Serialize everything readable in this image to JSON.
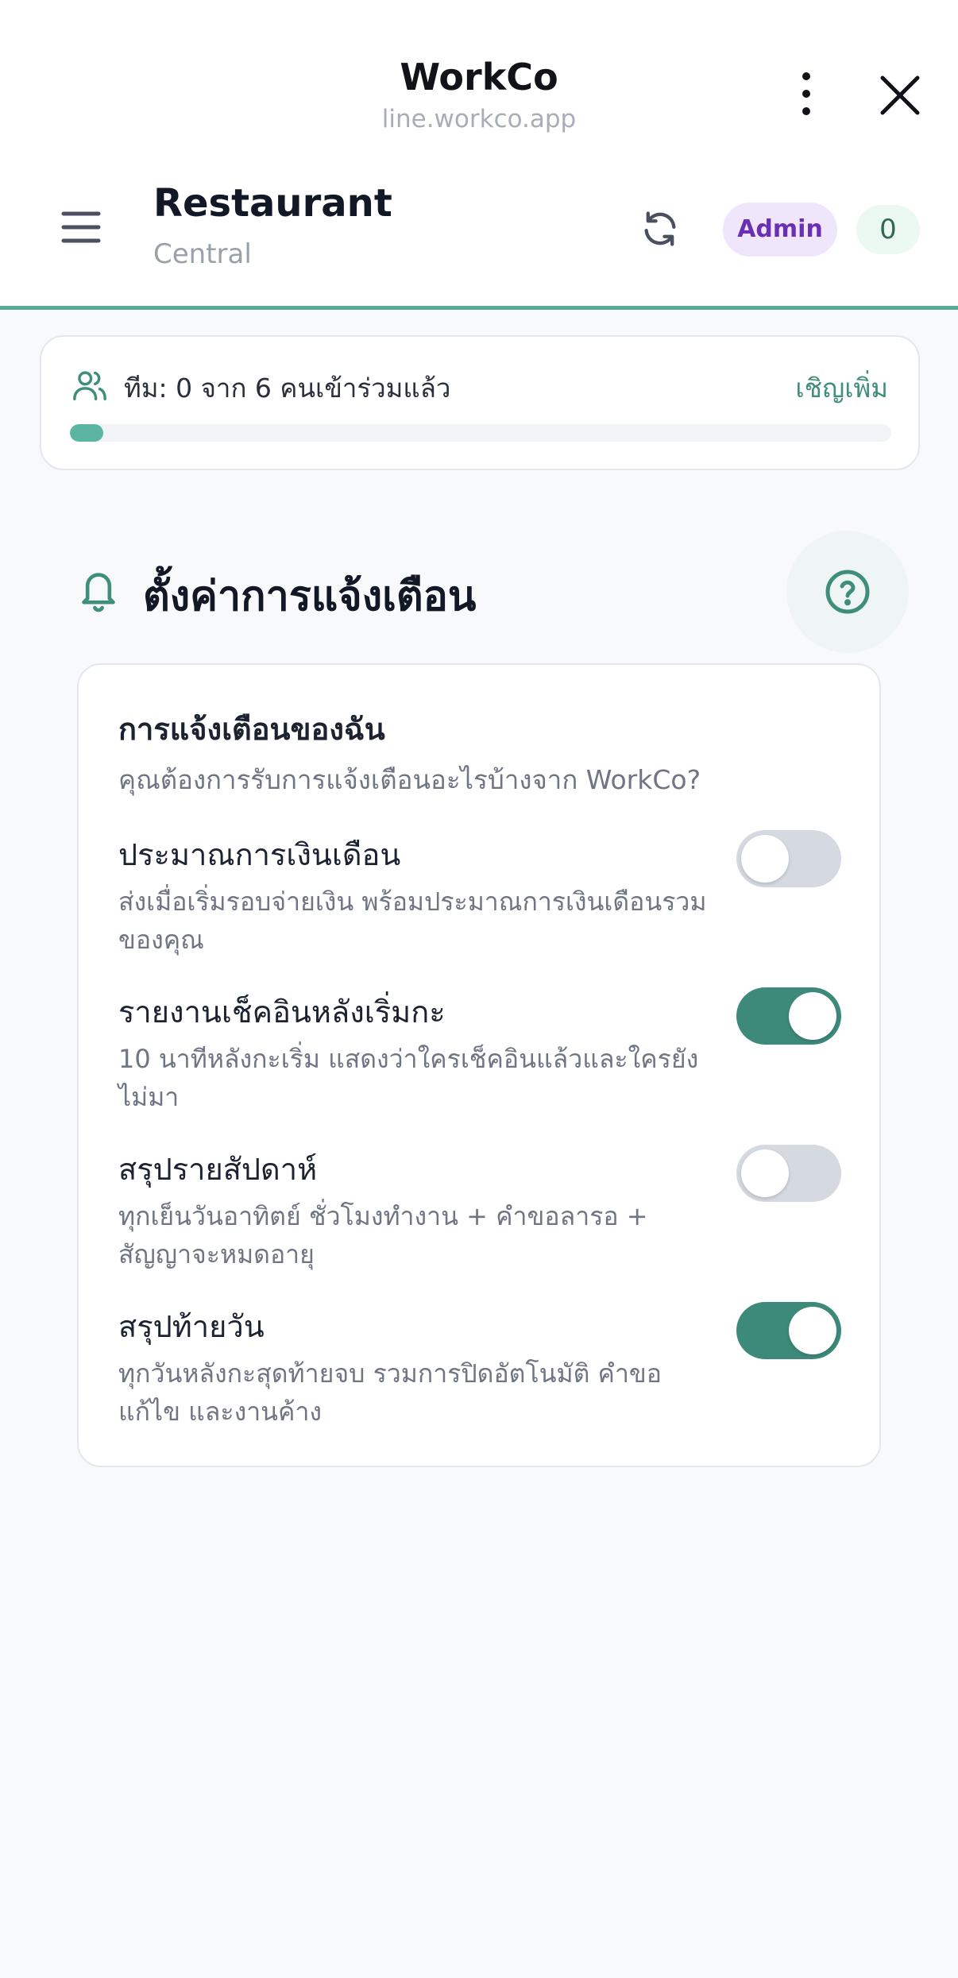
{
  "liff": {
    "title": "WorkCo",
    "url": "line.workco.app"
  },
  "header": {
    "workspace_name": "Restaurant",
    "branch": "Central",
    "role_badge": "Admin",
    "count_badge": "0"
  },
  "team": {
    "status_text": "ทีม: 0 จาก 6 คนเข้าร่วมแล้ว",
    "invite_label": "เชิญเพิ่ม",
    "joined": 0,
    "total": 6
  },
  "section": {
    "title": "ตั้งค่าการแจ้งเตือน"
  },
  "notifications": {
    "card_title": "การแจ้งเตือนของฉัน",
    "card_subtitle": "คุณต้องการรับการแจ้งเตือนอะไรบ้างจาก WorkCo?",
    "items": [
      {
        "name": "ประมาณการเงินเดือน",
        "desc": "ส่งเมื่อเริ่มรอบจ่ายเงิน พร้อมประมาณการเงินเดือนรวมของคุณ",
        "enabled": false
      },
      {
        "name": "รายงานเช็คอินหลังเริ่มกะ",
        "desc": "10 นาทีหลังกะเริ่ม แสดงว่าใครเช็คอินแล้วและใครยังไม่มา",
        "enabled": true
      },
      {
        "name": "สรุปรายสัปดาห์",
        "desc": "ทุกเย็นวันอาทิตย์ ชั่วโมงทำงาน + คำขอลารอ + สัญญาจะหมดอายุ",
        "enabled": false
      },
      {
        "name": "สรุปท้ายวัน",
        "desc": "ทุกวันหลังกะสุดท้ายจบ รวมการปิดอัตโนมัติ คำขอแก้ไข และงานค้าง",
        "enabled": true
      }
    ]
  },
  "colors": {
    "accent": "#3d8a7b",
    "progress": "#5bb5a2",
    "admin_badge_bg": "#efe6fb",
    "admin_badge_text": "#6b2fb3"
  },
  "icons": {
    "more": "more-vertical-icon",
    "close": "close-icon",
    "menu": "menu-icon",
    "refresh": "refresh-icon",
    "team": "users-icon",
    "bell": "bell-icon",
    "help": "help-circle-icon"
  }
}
